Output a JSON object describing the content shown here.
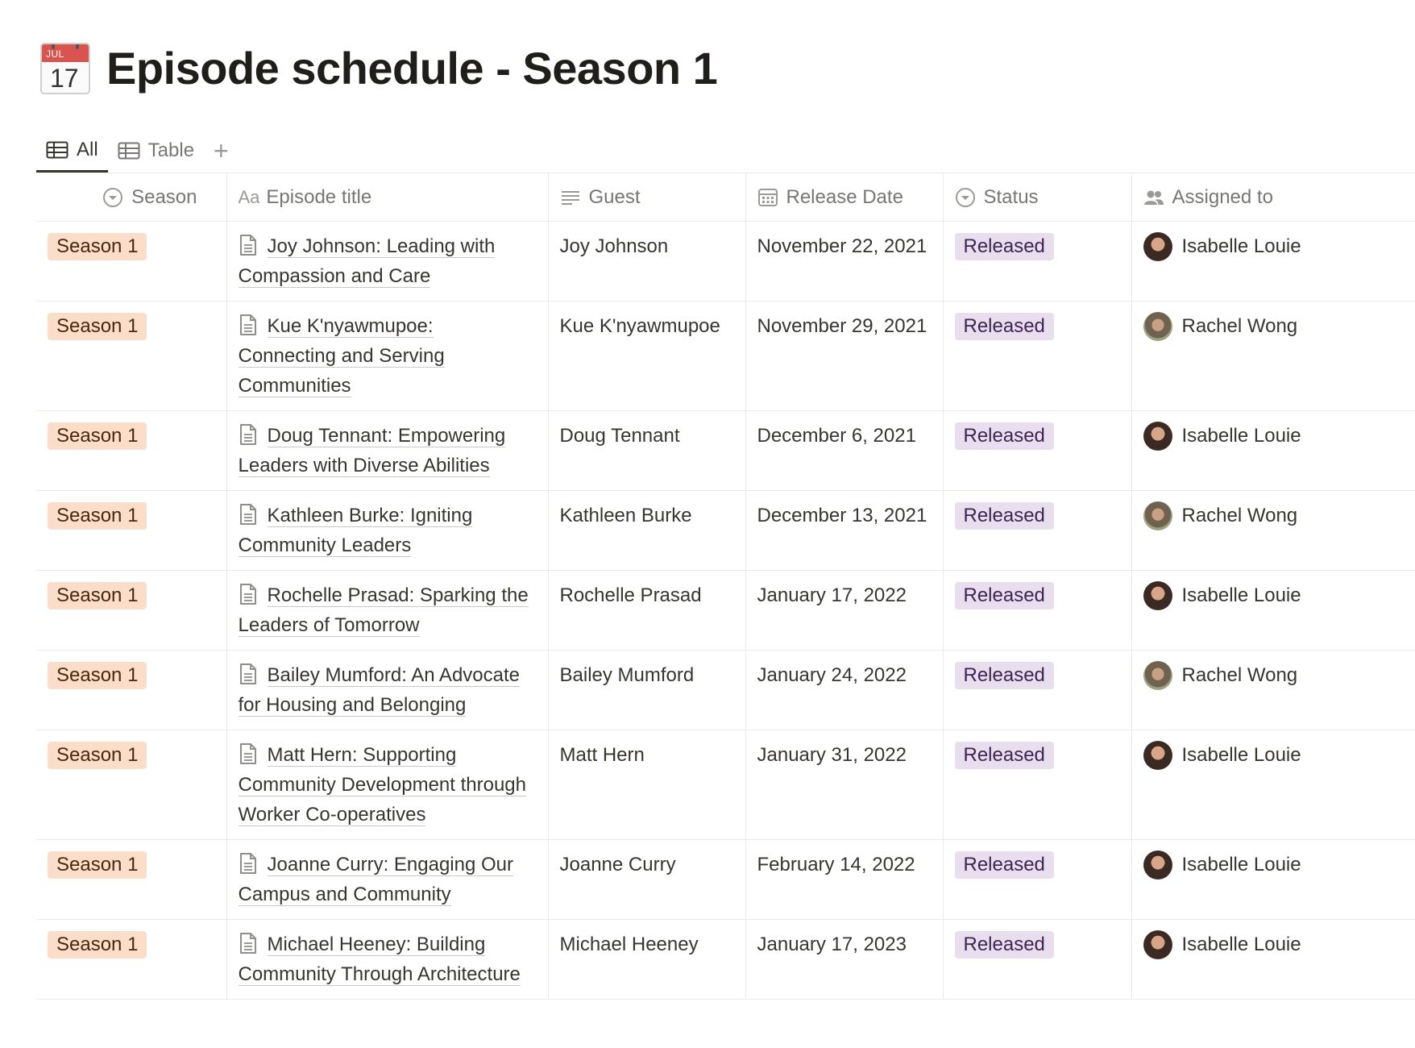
{
  "page": {
    "icon": {
      "name": "calendar-icon",
      "month": "JUL",
      "day": "17"
    },
    "title": "Episode schedule - Season 1"
  },
  "tabs": [
    {
      "label": "All",
      "icon": "table-icon",
      "active": true
    },
    {
      "label": "Table",
      "icon": "table-icon",
      "active": false
    }
  ],
  "add_view": "+",
  "columns": {
    "season": {
      "label": "Season",
      "icon": "select-icon"
    },
    "title": {
      "label": "Episode title",
      "icon": "Aa"
    },
    "guest": {
      "label": "Guest",
      "icon": "text-lines-icon"
    },
    "date": {
      "label": "Release Date",
      "icon": "calendar-icon"
    },
    "status": {
      "label": "Status",
      "icon": "select-icon"
    },
    "assigned": {
      "label": "Assigned to",
      "icon": "people-icon"
    }
  },
  "colors": {
    "season_tag_bg": "#fadec9",
    "season_tag_text": "#49290e",
    "status_tag_bg": "#e8deee",
    "status_tag_text": "#412454"
  },
  "rows": [
    {
      "season": "Season 1",
      "title": "Joy Johnson: Leading with Compassion and Care",
      "guest": "Joy Johnson",
      "date": "November 22, 2021",
      "status": "Released",
      "assigned": "Isabelle Louie"
    },
    {
      "season": "Season 1",
      "title": "Kue K'nyawmupoe: Connecting and Serving Communities",
      "guest": "Kue K'nyawmupoe",
      "date": "November 29, 2021",
      "status": "Released",
      "assigned": "Rachel Wong"
    },
    {
      "season": "Season 1",
      "title": "Doug Tennant: Empowering Leaders with Diverse Abilities",
      "guest": "Doug Tennant",
      "date": "December 6, 2021",
      "status": "Released",
      "assigned": "Isabelle Louie"
    },
    {
      "season": "Season 1",
      "title": "Kathleen Burke: Igniting Community Leaders",
      "guest": "Kathleen Burke",
      "date": "December 13, 2021",
      "status": "Released",
      "assigned": "Rachel Wong"
    },
    {
      "season": "Season 1",
      "title": "Rochelle Prasad: Sparking the Leaders of Tomorrow",
      "guest": "Rochelle Prasad",
      "date": "January 17, 2022",
      "status": "Released",
      "assigned": "Isabelle Louie"
    },
    {
      "season": "Season 1",
      "title": "Bailey Mumford: An Advocate for Housing and Belonging",
      "guest": "Bailey Mumford",
      "date": "January 24, 2022",
      "status": "Released",
      "assigned": "Rachel Wong"
    },
    {
      "season": "Season 1",
      "title": "Matt Hern: Supporting Community Development through Worker Co-operatives",
      "guest": "Matt Hern",
      "date": "January 31, 2022",
      "status": "Released",
      "assigned": "Isabelle Louie"
    },
    {
      "season": "Season 1",
      "title": "Joanne Curry: Engaging Our Campus and Community",
      "guest": "Joanne Curry",
      "date": "February 14, 2022",
      "status": "Released",
      "assigned": "Isabelle Louie"
    },
    {
      "season": "Season 1",
      "title": "Michael Heeney: Building Community Through Architecture",
      "guest": "Michael Heeney",
      "date": "January 17, 2023",
      "status": "Released",
      "assigned": "Isabelle Louie"
    }
  ]
}
